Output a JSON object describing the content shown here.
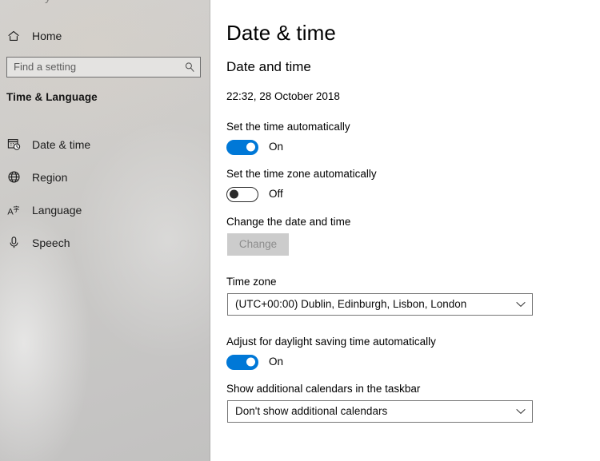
{
  "sidebar": {
    "ghost_text_top": "y",
    "home": {
      "label": "Home",
      "icon": "home-icon"
    },
    "search": {
      "value": "",
      "placeholder": "Find a setting",
      "icon": "search-icon"
    },
    "section_heading": "Time & Language",
    "items": [
      {
        "label": "Date & time",
        "icon": "calendar-clock-icon"
      },
      {
        "label": "Region",
        "icon": "globe-icon"
      },
      {
        "label": "Language",
        "icon": "language-icon"
      },
      {
        "label": "Speech",
        "icon": "microphone-icon"
      }
    ]
  },
  "main": {
    "page_title": "Date & time",
    "section_subtitle": "Date and time",
    "current_datetime": "22:32, 28 October 2018",
    "set_time_auto": {
      "label": "Set the time automatically",
      "state": "On"
    },
    "set_timezone_auto": {
      "label": "Set the time zone automatically",
      "state": "Off"
    },
    "change_datetime": {
      "label": "Change the date and time",
      "button_label": "Change"
    },
    "time_zone": {
      "label": "Time zone",
      "value": "(UTC+00:00) Dublin, Edinburgh, Lisbon, London"
    },
    "daylight_saving": {
      "label": "Adjust for daylight saving time automatically",
      "state": "On"
    },
    "additional_calendars": {
      "label": "Show additional calendars in the taskbar",
      "value": "Don't show additional calendars"
    }
  },
  "colors": {
    "accent": "#0078d7",
    "sidebar_bg": "#c9c8c6",
    "content_bg": "#ffffff",
    "text": "#000000",
    "disabled_button_bg": "#cccccc",
    "disabled_button_text": "#8d8d8d",
    "control_border": "#767676"
  }
}
